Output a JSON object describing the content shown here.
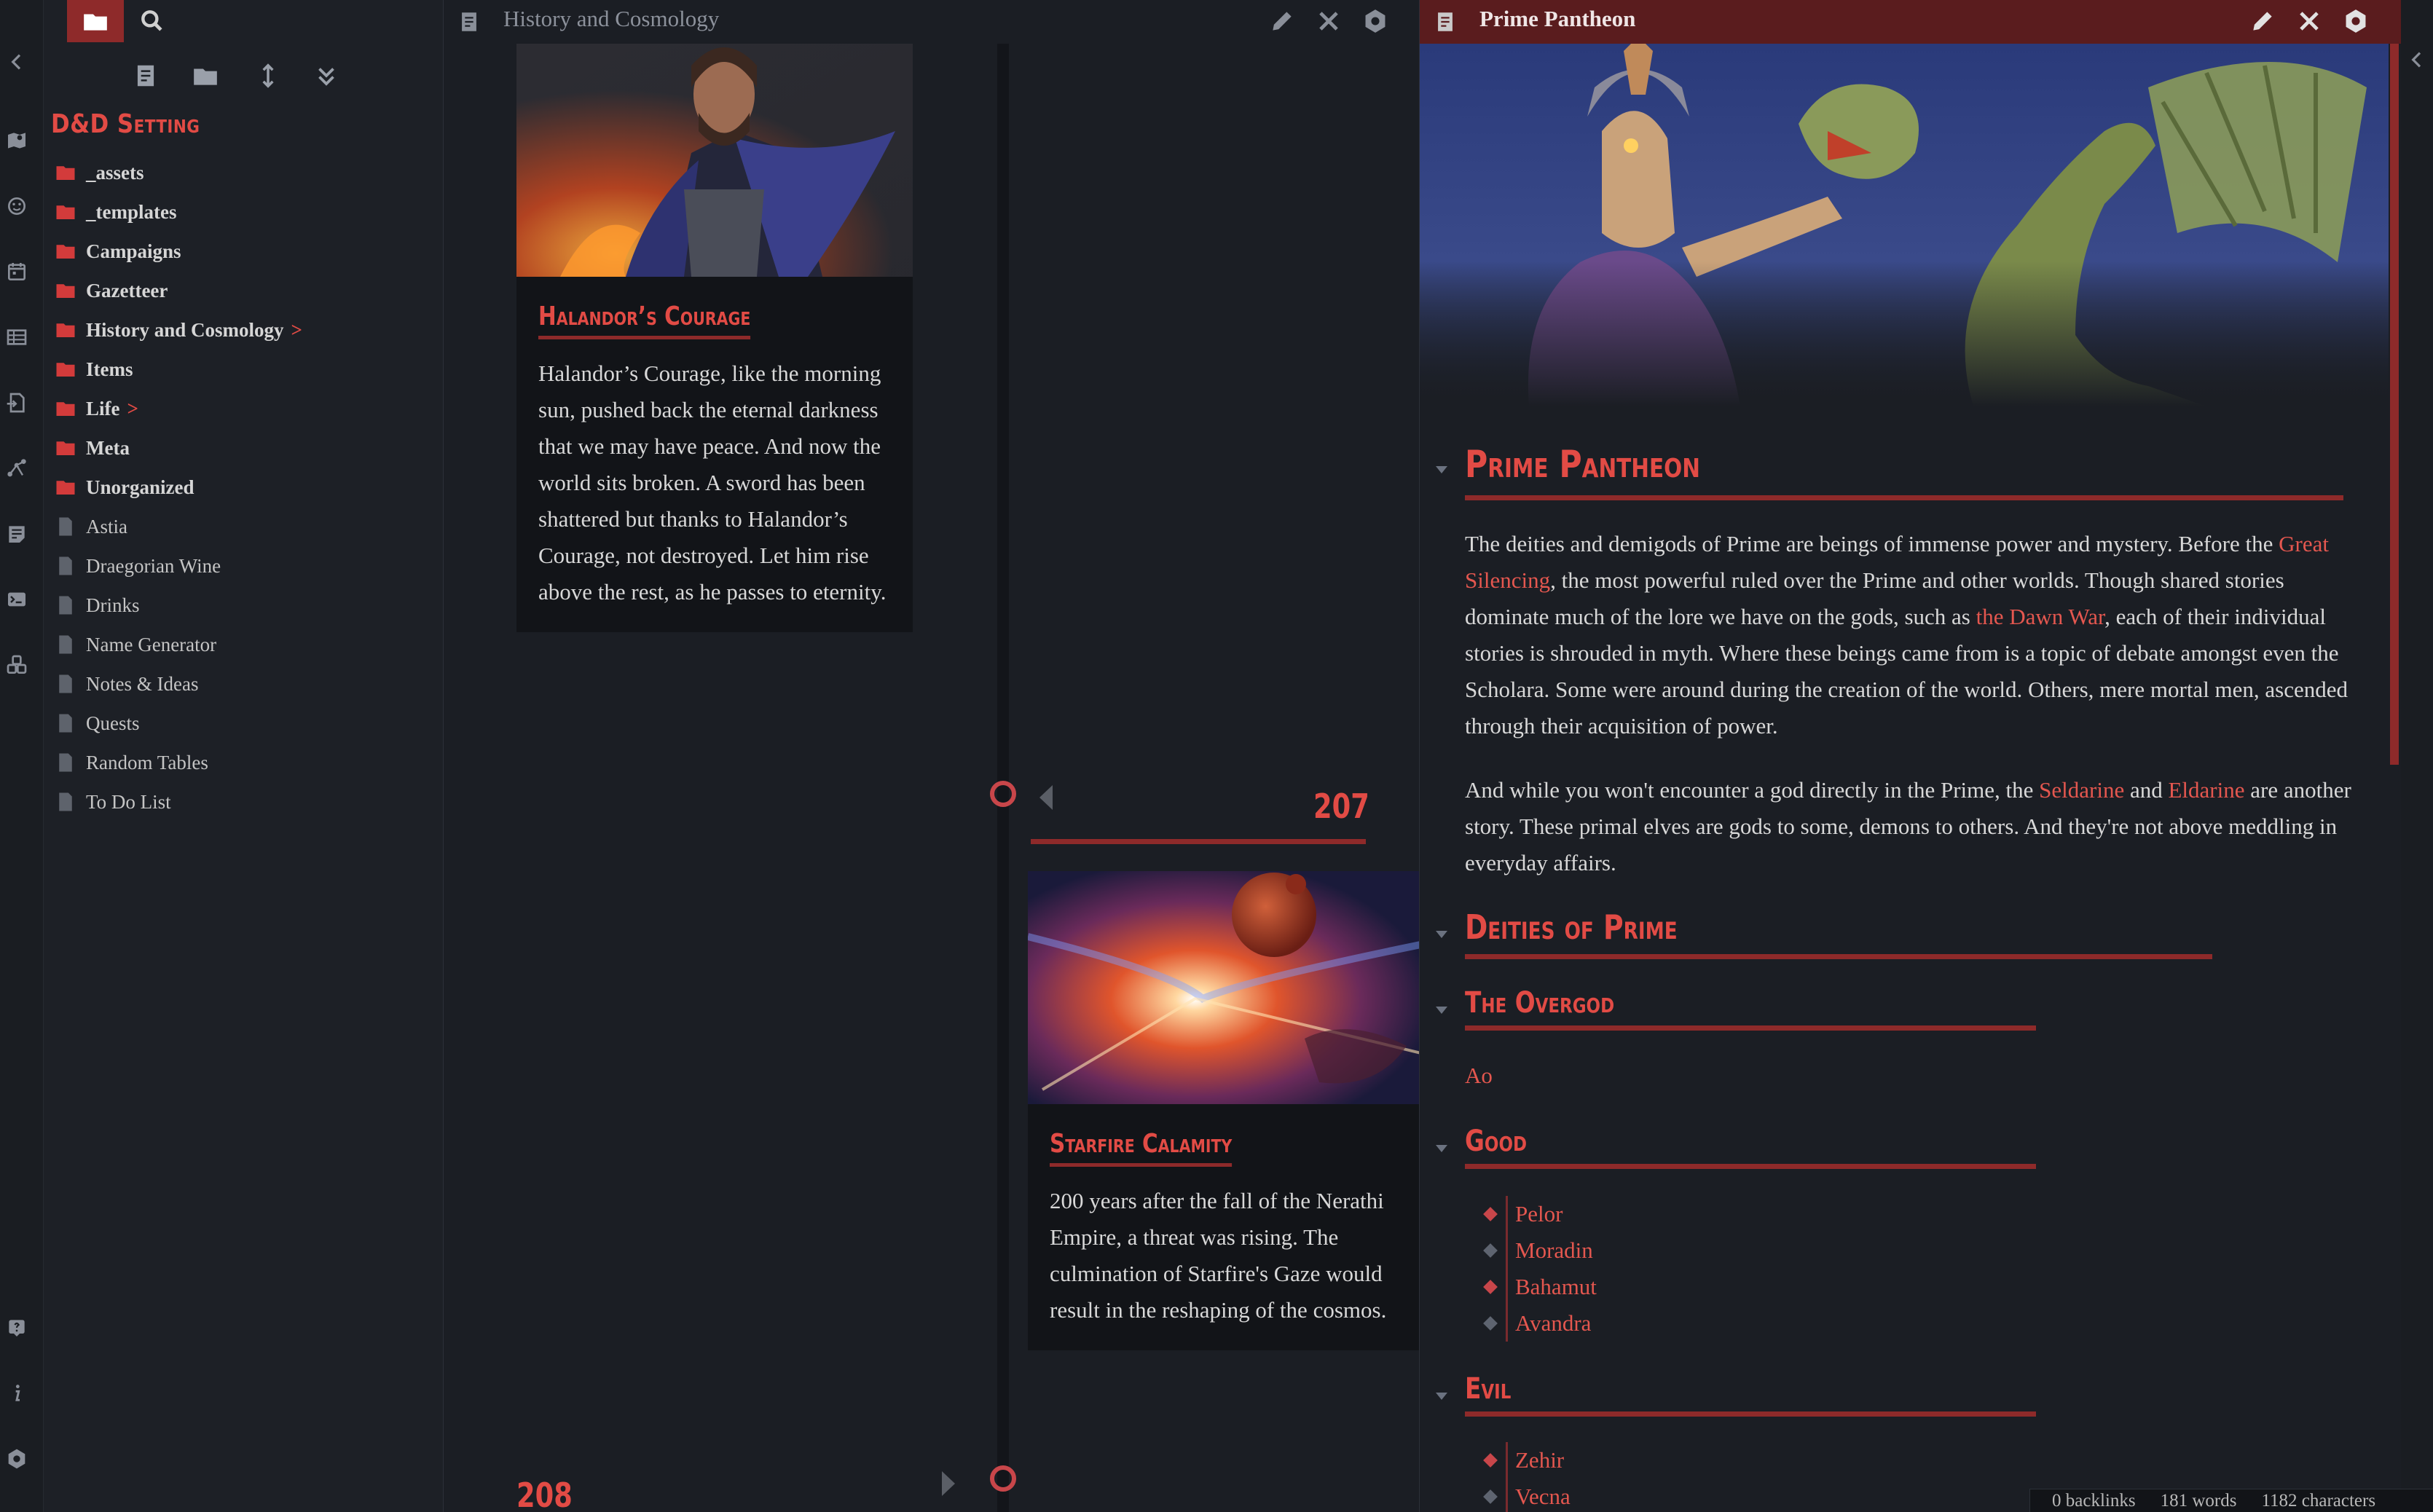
{
  "vault_name": "D&D Setting",
  "sidebar": {
    "tree": [
      {
        "type": "folder",
        "label": "_assets"
      },
      {
        "type": "folder",
        "label": "_templates"
      },
      {
        "type": "folder",
        "label": "Campaigns"
      },
      {
        "type": "folder",
        "label": "Gazetteer"
      },
      {
        "type": "folder",
        "label": "History and Cosmology",
        "arrow": ">"
      },
      {
        "type": "folder",
        "label": "Items"
      },
      {
        "type": "folder",
        "label": "Life",
        "arrow": ">"
      },
      {
        "type": "folder",
        "label": "Meta"
      },
      {
        "type": "folder",
        "label": "Unorganized"
      },
      {
        "type": "file",
        "label": "Astia"
      },
      {
        "type": "file",
        "label": "Draegorian Wine"
      },
      {
        "type": "file",
        "label": "Drinks"
      },
      {
        "type": "file",
        "label": "Name Generator"
      },
      {
        "type": "file",
        "label": "Notes & Ideas"
      },
      {
        "type": "file",
        "label": "Quests"
      },
      {
        "type": "file",
        "label": "Random Tables"
      },
      {
        "type": "file",
        "label": "To Do List"
      }
    ]
  },
  "left_pane": {
    "title": "History and Cosmology",
    "cards": [
      {
        "title": "Halandor’s Courage",
        "text": "Halandor’s Courage, like the morning sun, pushed back the eternal darkness that we may have peace. And now the world sits broken. A sword has been shattered but thanks to Halandor’s Courage, not destroyed. Let him rise above the rest, as he passes to eternity."
      },
      {
        "title": "Starfire Calamity",
        "text": "200 years after the fall of the Nerathi Empire, a threat was rising. The culmination of Starfire's Gaze would result in the reshaping of the cosmos."
      }
    ],
    "years": [
      "207",
      "208"
    ]
  },
  "right_pane": {
    "title": "Prime Pantheon",
    "h1": "Prime Pantheon",
    "p1": {
      "a": "The deities and demigods of Prime are beings of immense power and mystery. Before the ",
      "link1": "Great Silencing",
      "b": ", the most powerful ruled over the Prime and other worlds. Though shared stories dominate much of the lore we have on the gods, such as ",
      "link2": "the Dawn War",
      "c": ", each of their individual stories is shrouded in myth. Where these beings came from is a topic of debate amongst even the Scholara. Some were around during the creation of the world. Others, mere mortal men, ascended through their acquisition of power."
    },
    "p2": {
      "a": "And while you won't encounter a god directly in the Prime, the ",
      "link1": "Seldarine",
      "b": " and ",
      "link2": "Eldarine",
      "c": " are another story. These primal elves are gods to some, demons to others. And they're not above meddling in everyday affairs."
    },
    "h2": "Deities of Prime",
    "h3_overgod": "The Overgod",
    "overgod": "Ao",
    "h3_good": "Good",
    "good": [
      "Pelor",
      "Moradin",
      "Bahamut",
      "Avandra"
    ],
    "h3_evil": "Evil",
    "evil": [
      "Zehir",
      "Vecna"
    ]
  },
  "status": {
    "backlinks": "0 backlinks",
    "words": "181 words",
    "characters": "1182 characters"
  },
  "colors": {
    "accent": "#e24b45",
    "accent_dark": "#8e2a2a",
    "background": "#1b1e24"
  }
}
